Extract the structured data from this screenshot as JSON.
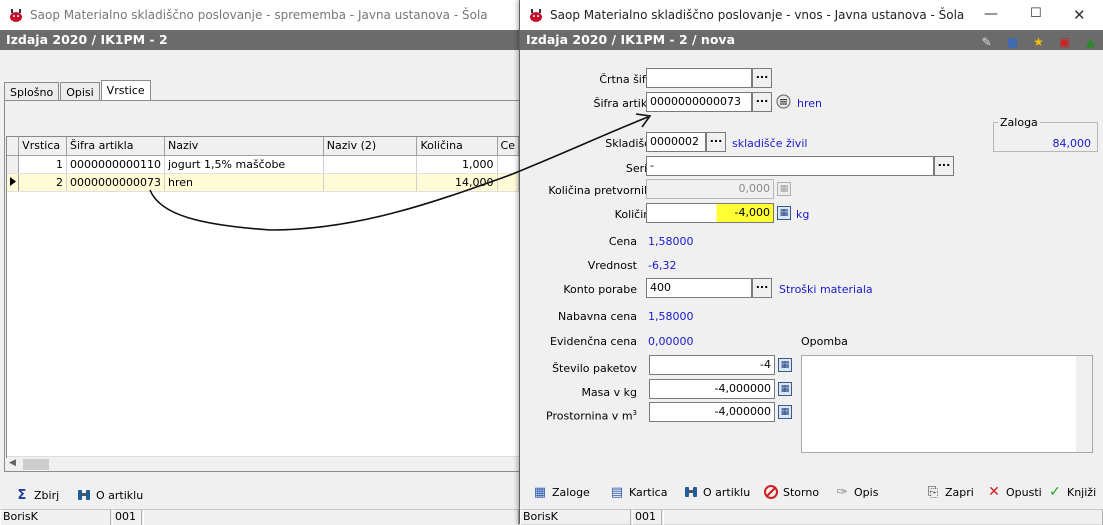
{
  "colors": {
    "accent_blue": "#1a1acc",
    "highlight_yellow": "#ffff33",
    "subtitle_bg": "#6b6b6b"
  },
  "back": {
    "window_title": "Saop Materialno skladiščno poslovanje - sprememba - Javna ustanova - Šola",
    "subtitle": "Izdaja 2020 / IK1PM - 2",
    "tabs": [
      {
        "label": "Splošno"
      },
      {
        "label": "Opisi"
      },
      {
        "label": "Vrstice"
      }
    ],
    "grid": {
      "headers": [
        "Vrstica",
        "Šifra artikla",
        "Naziv",
        "Naziv (2)",
        "Količina",
        "Ce"
      ],
      "rows": [
        {
          "no": "1",
          "code": "0000000000110",
          "name": "jogurt 1,5% maščobe",
          "name2": "",
          "qty": "1,000"
        },
        {
          "no": "2",
          "code": "0000000000073",
          "name": "hren",
          "name2": "",
          "qty": "14,000"
        }
      ]
    },
    "buttons": {
      "collect": "Zbirj",
      "about": "O artiklu"
    },
    "status": {
      "user": "BorisK",
      "code": "001"
    }
  },
  "front": {
    "window_title": "Saop Materialno skladiščno poslovanje - vnos - Javna ustanova - Šola",
    "subtitle": "Izdaja 2020 / IK1PM - 2 / nova",
    "form": {
      "barcode_label": "Črtna šifra",
      "barcode_value": "",
      "article_code_label": "Šifra artikla",
      "article_code_value": "0000000000073",
      "article_name": "hren",
      "stock_group_label": "Zaloga",
      "stock_value": "84,000",
      "warehouse_label": "Skladišče",
      "warehouse_value": "0000002",
      "warehouse_name": "skladišče živil",
      "series_label": "Serija",
      "series_value": "-",
      "converter_qty_label": "Količina pretvornika",
      "converter_qty_value": "0,000",
      "qty_label": "Količina",
      "qty_value": "-4,000",
      "qty_unit": "kg",
      "price_label": "Cena",
      "price_value": "1,58000",
      "value_label": "Vrednost",
      "value_value": "-6,32",
      "account_label": "Konto porabe",
      "account_value": "400",
      "account_name": "Stroški materiala",
      "purchase_price_label": "Nabavna cena",
      "purchase_price_value": "1,58000",
      "record_price_label": "Evidenčna cena",
      "record_price_value": "0,00000",
      "note_label": "Opomba",
      "packages_label": "Število paketov",
      "packages_value": "-4",
      "mass_label": "Masa v kg",
      "mass_value": "-4,000000",
      "volume_label": "Prostornina v m",
      "volume_sup": "3",
      "volume_value": "-4,000000"
    },
    "buttons": {
      "stock": "Zaloge",
      "card": "Kartica",
      "about": "O artiklu",
      "cancel_entry": "Storno",
      "desc": "Opis",
      "close": "Zapri",
      "abandon": "Opusti",
      "post": "Knjiži"
    },
    "status": {
      "user": "BorisK",
      "code": "001"
    }
  }
}
